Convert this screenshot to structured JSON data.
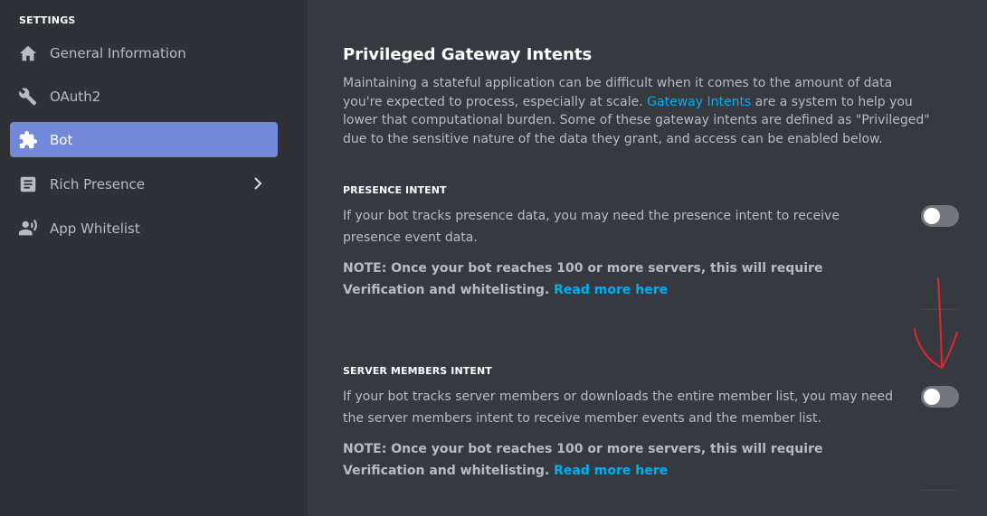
{
  "sidebar": {
    "heading": "SETTINGS",
    "items": [
      {
        "label": "General Information",
        "icon": "home-icon"
      },
      {
        "label": "OAuth2",
        "icon": "wrench-icon"
      },
      {
        "label": "Bot",
        "icon": "puzzle-icon",
        "active": true
      },
      {
        "label": "Rich Presence",
        "icon": "document-icon",
        "has_submenu": true
      },
      {
        "label": "App Whitelist",
        "icon": "user-list-icon"
      }
    ]
  },
  "main": {
    "title": "Privileged Gateway Intents",
    "intro": {
      "before_link": "Maintaining a stateful application can be difficult when it comes to the amount of data you're expected to process, especially at scale. ",
      "link": "Gateway Intents",
      "after_link": " are a system to help you lower that computational burden. Some of these gateway intents are defined as \"Privileged\" due to the sensitive nature of the data they grant, and access can be enabled below."
    },
    "sections": [
      {
        "title": "PRESENCE INTENT",
        "description": "If your bot tracks presence data, you may need the presence intent to receive presence event data.",
        "note": "NOTE: Once your bot reaches 100 or more servers, this will require Verification and whitelisting.",
        "note_link": "Read more here",
        "enabled": false
      },
      {
        "title": "SERVER MEMBERS INTENT",
        "description": "If your bot tracks server members or downloads the entire member list, you may need the server members intent to receive member events and the member list.",
        "note": "NOTE: Once your bot reaches 100 or more servers, this will require Verification and whitelisting.",
        "note_link": "Read more here",
        "enabled": false
      }
    ]
  },
  "colors": {
    "sidebar_bg": "#2f3136",
    "main_bg": "#36393f",
    "active_item": "#7289da",
    "link": "#00b0f4",
    "toggle_off": "#72767d",
    "annotation_arrow": "#e32727"
  }
}
